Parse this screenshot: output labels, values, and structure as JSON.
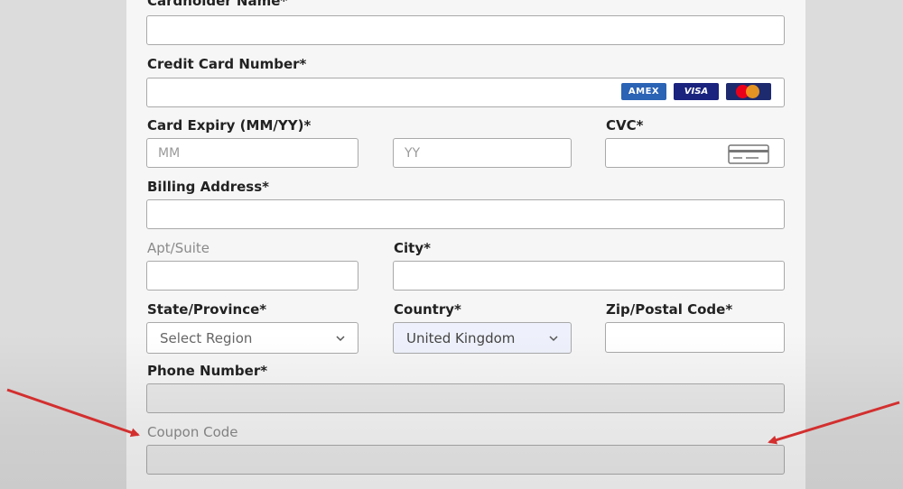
{
  "form": {
    "cardholder_name_label": "Cardholder Name*",
    "card_number_label": "Credit Card Number*",
    "card_brands": [
      "AMEX",
      "VISA",
      "mastercard"
    ],
    "card_expiry_label": "Card Expiry (MM/YY)*",
    "expiry_month_placeholder": "MM",
    "expiry_year_placeholder": "YY",
    "cvc_label": "CVC*",
    "billing_address_label": "Billing Address*",
    "apt_suite_label": "Apt/Suite",
    "city_label": "City*",
    "state_label": "State/Province*",
    "state_selected": "Select Region",
    "country_label": "Country*",
    "country_selected": "United Kingdom",
    "zip_label": "Zip/Postal Code*",
    "phone_label": "Phone Number*",
    "coupon_label": "Coupon Code"
  },
  "annotations": {
    "arrow_color": "#d32f2f"
  },
  "icons": {
    "cvc": "credit-card-icon",
    "dropdown": "chevron-down-icon"
  }
}
